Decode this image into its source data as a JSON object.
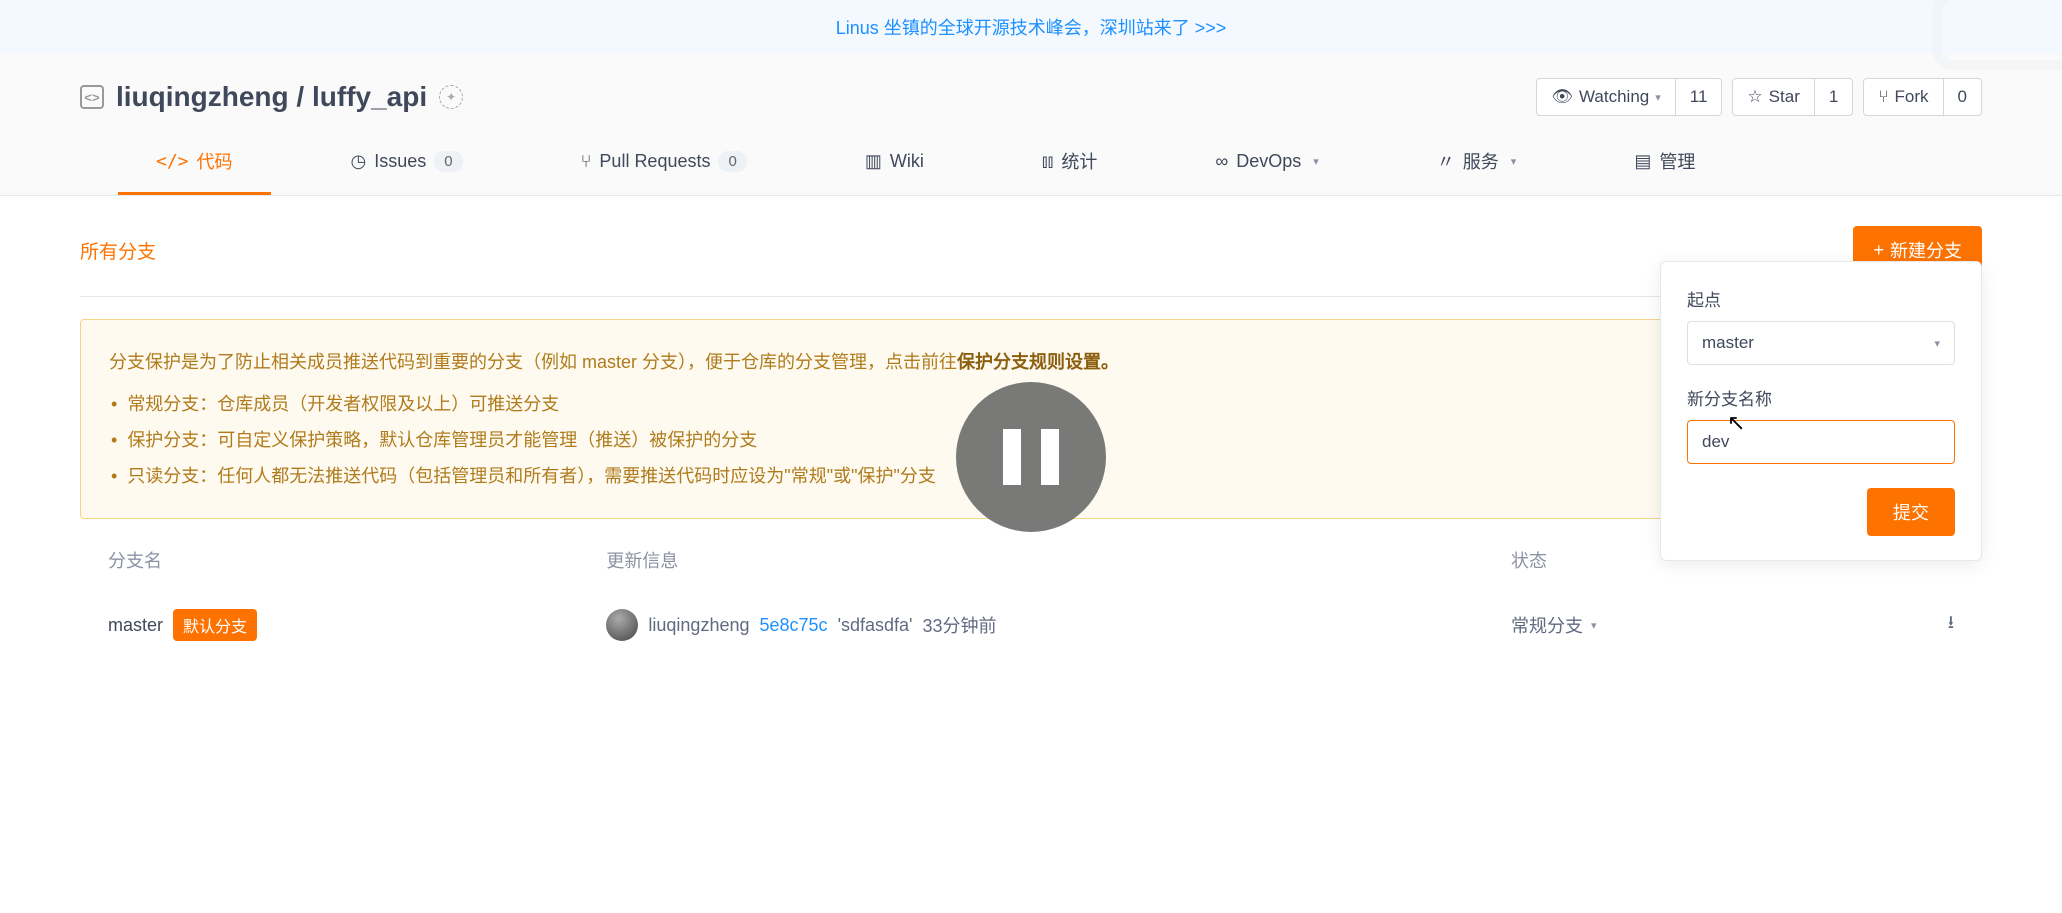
{
  "banner": {
    "text": "Linus 坐镇的全球开源技术峰会，深圳站来了 >>>"
  },
  "repo": {
    "owner": "liuqingzheng",
    "sep": " / ",
    "name": "luffy_api"
  },
  "headerActions": {
    "watch": {
      "label": "Watching",
      "count": "11"
    },
    "star": {
      "label": "Star",
      "count": "1"
    },
    "fork": {
      "label": "Fork",
      "count": "0"
    }
  },
  "tabs": {
    "code": "代码",
    "issues": {
      "label": "Issues",
      "count": "0"
    },
    "pr": {
      "label": "Pull Requests",
      "count": "0"
    },
    "wiki": "Wiki",
    "stats": "统计",
    "devops": "DevOps",
    "service": "服务",
    "admin": "管理"
  },
  "section": {
    "title": "所有分支",
    "newBranch": "新建分支"
  },
  "notice": {
    "intro1": "分支保护是为了防止相关成员推送代码到重要的分支（例如 master 分支），便于仓库的分支管理，点击前往",
    "introBold": "保护分支规则设置。",
    "item1": "常规分支：仓库成员（开发者权限及以上）可推送分支",
    "item2": "保护分支：可自定义保护策略，默认仓库管理员才能管理（推送）被保护的分支",
    "item3": "只读分支：任何人都无法推送代码（包括管理员和所有者），需要推送代码时应设为\"常规\"或\"保护\"分支"
  },
  "tableHead": {
    "col1": "分支名",
    "col2": "更新信息",
    "col3": "状态"
  },
  "row": {
    "name": "master",
    "badge": "默认分支",
    "author": "liuqingzheng",
    "hash": "5e8c75c",
    "msg": "'sdfasdfa'",
    "time": "33分钟前",
    "status": "常规分支"
  },
  "popover": {
    "startLabel": "起点",
    "startValue": "master",
    "nameLabel": "新分支名称",
    "nameValue": "dev",
    "submit": "提交"
  }
}
